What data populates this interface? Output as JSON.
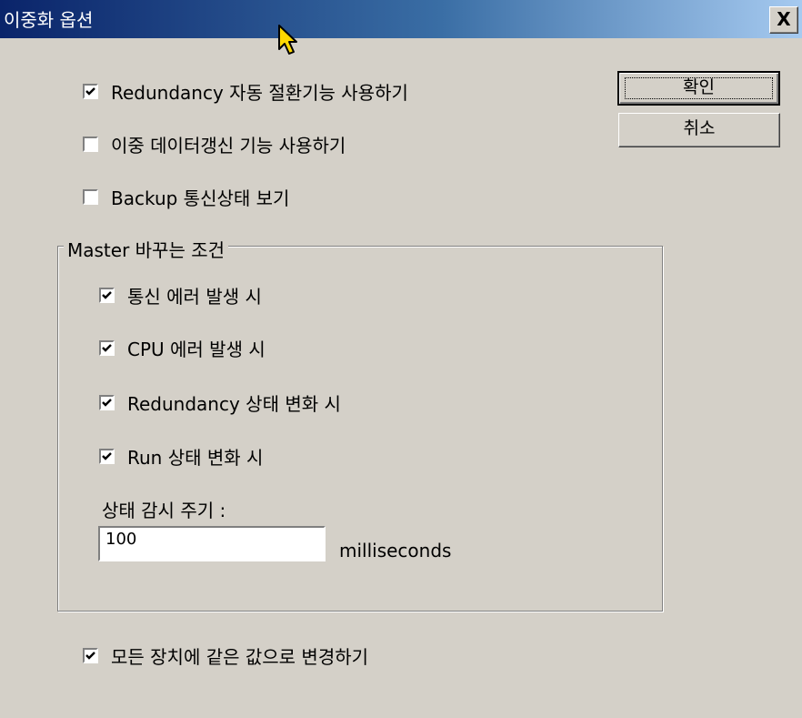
{
  "window": {
    "title": "이중화 옵션",
    "close_label": "X"
  },
  "options": [
    {
      "label": "Redundancy 자동 절환기능 사용하기",
      "checked": true
    },
    {
      "label": "이중 데이터갱신 기능 사용하기",
      "checked": false
    },
    {
      "label": "Backup 통신상태 보기",
      "checked": false
    }
  ],
  "buttons": {
    "ok_label": "확인",
    "cancel_label": "취소"
  },
  "master_group": {
    "title": "Master 바꾸는 조건",
    "conditions": [
      {
        "label": "통신 에러 발생 시",
        "checked": true
      },
      {
        "label": "CPU 에러 발생 시",
        "checked": true
      },
      {
        "label": "Redundancy 상태 변화 시",
        "checked": true
      },
      {
        "label": "Run 상태 변화 시",
        "checked": true
      }
    ],
    "interval_label": "상태 감시 주기 :",
    "interval_value": "100",
    "interval_unit": "milliseconds"
  },
  "apply_all": {
    "label": "모든 장치에 같은 값으로 변경하기",
    "checked": true
  }
}
